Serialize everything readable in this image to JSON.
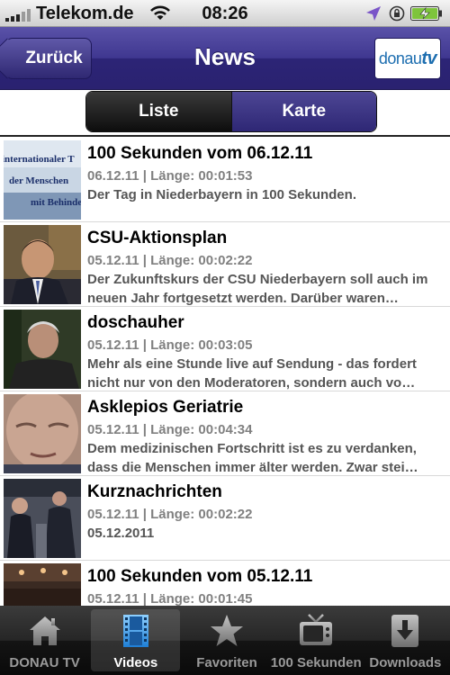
{
  "status_bar": {
    "carrier": "Telekom.de",
    "time": "08:26"
  },
  "nav": {
    "back_label": "Zurück",
    "title": "News",
    "logo_text": "donau",
    "logo_tv": "tv"
  },
  "segment": {
    "items": [
      "Liste",
      "Karte"
    ],
    "selected": "Liste"
  },
  "items": [
    {
      "title": "100 Sekunden vom 06.12.11",
      "meta": "06.12.11 | Länge: 00:01:53",
      "desc": "Der Tag in Niederbayern in 100 Sekunden.",
      "thumb_text": "internationaler T der Menschen mit Behinde"
    },
    {
      "title": "CSU-Aktionsplan",
      "meta": "05.12.11 | Länge: 00:02:22",
      "desc": "Der Zukunftskurs der CSU Niederbayern soll auch im neuen Jahr fortgesetzt werden. Darüber waren…"
    },
    {
      "title": "doschauher",
      "meta": "05.12.11 | Länge: 00:03:05",
      "desc": "Mehr als eine Stunde live auf Sendung - das fordert nicht nur von den Moderatoren, sondern auch vo…"
    },
    {
      "title": "Asklepios Geriatrie",
      "meta": "05.12.11 | Länge: 00:04:34",
      "desc": "Dem medizinischen Fortschritt ist es zu verdanken, dass die Menschen immer älter werden. Zwar stei…"
    },
    {
      "title": "Kurznachrichten",
      "meta": "05.12.11 | Länge: 00:02:22",
      "desc": "05.12.2011"
    },
    {
      "title": "100 Sekunden vom 05.12.11",
      "meta": "05.12.11 | Länge: 00:01:45",
      "desc": ""
    }
  ],
  "tabs": [
    {
      "label": "DONAU TV",
      "icon": "house-icon"
    },
    {
      "label": "Videos",
      "icon": "film-icon",
      "active": true
    },
    {
      "label": "Favoriten",
      "icon": "star-icon"
    },
    {
      "label": "100 Sekunden",
      "icon": "tv-icon"
    },
    {
      "label": "Downloads",
      "icon": "download-icon"
    }
  ]
}
